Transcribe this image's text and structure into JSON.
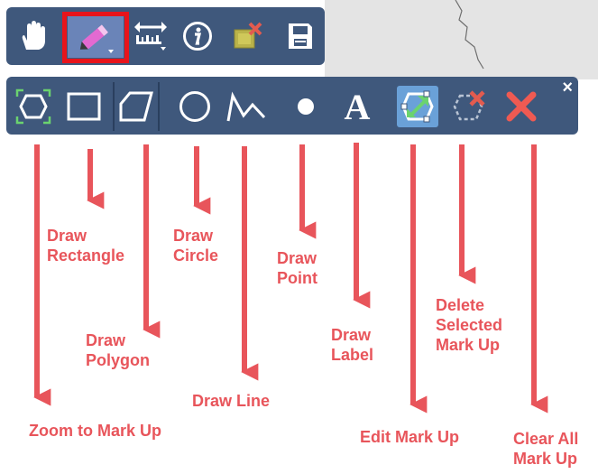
{
  "toolbar_top": {
    "buttons": [
      {
        "name": "pan-hand-icon"
      },
      {
        "name": "markup-pencil-icon"
      },
      {
        "name": "measure-ruler-icon"
      },
      {
        "name": "identify-info-icon"
      },
      {
        "name": "clear-selection-icon"
      },
      {
        "name": "save-floppy-icon"
      }
    ]
  },
  "toolbar_markup": {
    "buttons": [
      {
        "name": "zoom-to-markup-icon"
      },
      {
        "name": "draw-rectangle-icon"
      },
      {
        "name": "draw-polygon-icon"
      },
      {
        "name": "draw-circle-icon"
      },
      {
        "name": "draw-line-icon"
      },
      {
        "name": "draw-point-icon"
      },
      {
        "name": "draw-label-icon",
        "glyph": "A"
      },
      {
        "name": "edit-markup-icon"
      },
      {
        "name": "delete-selected-icon"
      },
      {
        "name": "clear-all-icon"
      }
    ],
    "close_glyph": "×"
  },
  "labels": {
    "draw_rectangle": [
      "Draw",
      "Rectangle"
    ],
    "draw_circle": [
      "Draw",
      "Circle"
    ],
    "draw_point": [
      "Draw",
      "Point"
    ],
    "draw_polygon": [
      "Draw",
      "Polygon"
    ],
    "draw_label": [
      "Draw",
      "Label"
    ],
    "delete_selected": [
      "Delete",
      "Selected",
      "Mark Up"
    ],
    "draw_line": "Draw Line",
    "zoom_to_markup": "Zoom to Mark Up",
    "edit_markup": "Edit Mark Up",
    "clear_all": [
      "Clear All",
      "Mark Up"
    ]
  },
  "colors": {
    "toolbar": "#3f587c",
    "highlight": "#e8141b",
    "annotation": "#e8555b",
    "active_tile": "#6aa1d8"
  }
}
